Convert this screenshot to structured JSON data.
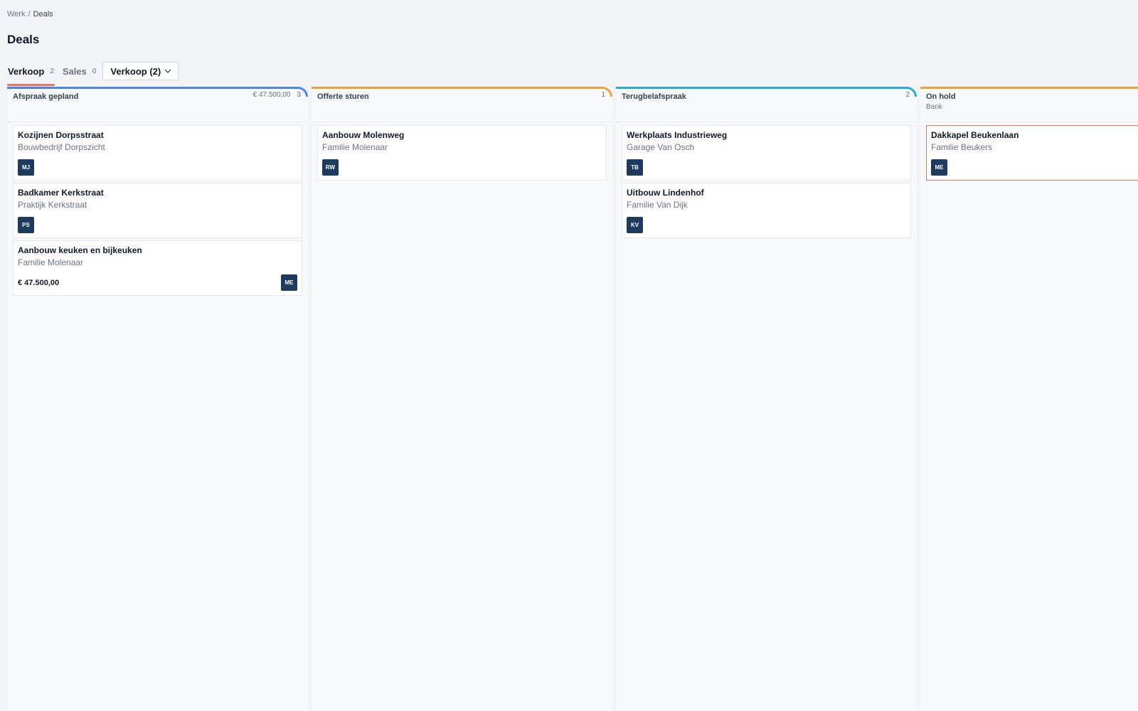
{
  "breadcrumb": {
    "root": "Werk",
    "separator": "/",
    "current": "Deals"
  },
  "page": {
    "title": "Deals"
  },
  "tabs": [
    {
      "label": "Verkoop",
      "count": "2",
      "active": true
    },
    {
      "label": "Sales",
      "count": "0",
      "active": false
    }
  ],
  "pipeline_select": {
    "value": "Verkoop (2)"
  },
  "colors": {
    "col_afspraak": "#4a86e8",
    "col_offerte": "#e8a33d",
    "col_terugbel": "#27aec8",
    "col_onhold": "#e8a33d",
    "tab_active": "#e8765b",
    "avatar_bg": "#1e3a5f"
  },
  "columns": [
    {
      "title": "Afspraak gepland",
      "amount": "€ 47.500,00",
      "count": "3",
      "cards": [
        {
          "title": "Kozijnen Dorpsstraat",
          "subtitle": "Bouwbedrijf Dorpszicht",
          "avatar": "MJ"
        },
        {
          "title": "Badkamer Kerkstraat",
          "subtitle": "Praktijk Kerkstraat",
          "avatar": "PS"
        },
        {
          "title": "Aanbouw keuken en bijkeuken",
          "subtitle": "Familie Molenaar",
          "amount": "€ 47.500,00",
          "avatar": "ME"
        }
      ]
    },
    {
      "title": "Offerte sturen",
      "count": "1",
      "cards": [
        {
          "title": "Aanbouw Molenweg",
          "subtitle": "Familie Molenaar",
          "avatar": "RW"
        }
      ]
    },
    {
      "title": "Terugbelafspraak",
      "count": "2",
      "cards": [
        {
          "title": "Werkplaats Industrieweg",
          "subtitle": "Garage Van Osch",
          "avatar": "TB"
        },
        {
          "title": "Uitbouw Lindenhof",
          "subtitle": "Familie Van Dijk",
          "avatar": "KV"
        }
      ]
    },
    {
      "title": "On hold",
      "subtitle": "Bank",
      "cards": [
        {
          "title": "Dakkapel Beukenlaan",
          "subtitle": "Familie Beukers",
          "avatar": "ME"
        }
      ]
    }
  ]
}
